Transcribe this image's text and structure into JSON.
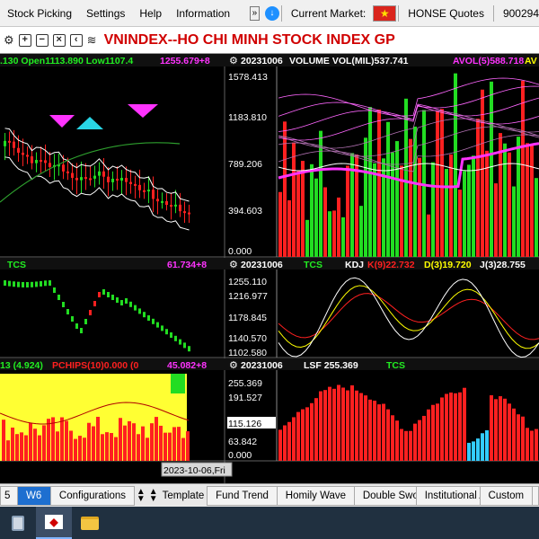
{
  "menu": {
    "items": [
      "Stock Picking",
      "Settings",
      "Help",
      "Information"
    ],
    "current_market_label": "Current Market:",
    "quotes_label": "HONSE Quotes",
    "code_fragment": "900294"
  },
  "toolbar": {
    "title": "VNINDEX--HO CHI MINH STOCK INDEX  GP"
  },
  "panels": {
    "price": {
      "header_left": ".130 Open1113.890 Low1107.4",
      "header_right": "1255.679+8"
    },
    "volume": {
      "date": "20231006",
      "header": "VOLUME VOL(MIL)537.741",
      "avol": "AVOL(5)588.718",
      "extra": "AV",
      "axis": [
        "1578.413",
        "1183.810",
        "789.206",
        "394.603",
        "0.000"
      ]
    },
    "tcs_left": {
      "label": "TCS",
      "value": "61.734+8"
    },
    "kdj": {
      "date": "20231006",
      "label": "TCS",
      "kdj": "KDJ",
      "k": "K(9)22.732",
      "d": "D(3)19.720",
      "j": "J(3)28.755",
      "axis": [
        "1255.110",
        "1216.977",
        "1178.845",
        "1140.570",
        "1102.580"
      ]
    },
    "pchips": {
      "prefix": "13 (4.924)",
      "label": "PCHIPS(10)0.000 (0",
      "value": "45.082+8"
    },
    "lsf": {
      "date": "20231006",
      "label": "LSF 255.369",
      "tcs": "TCS",
      "axis": [
        "255.369",
        "191.527",
        "115.126",
        "63.842",
        "0.000"
      ]
    },
    "cursor_date": "2023-10-06,Fri"
  },
  "tabs": {
    "left_fragment": "5",
    "items": [
      "W6",
      "Configurations",
      "Template",
      "Fund Trend",
      "Homily Wave",
      "Double Sword",
      "Institutional A",
      "Custom"
    ],
    "active": "W6"
  },
  "colors": {
    "up": "#22dd22",
    "down": "#ff2020",
    "title": "#d00000",
    "accent": "#ff33ff",
    "volume_header": "#ffffff",
    "tcs": "#22ee22"
  }
}
